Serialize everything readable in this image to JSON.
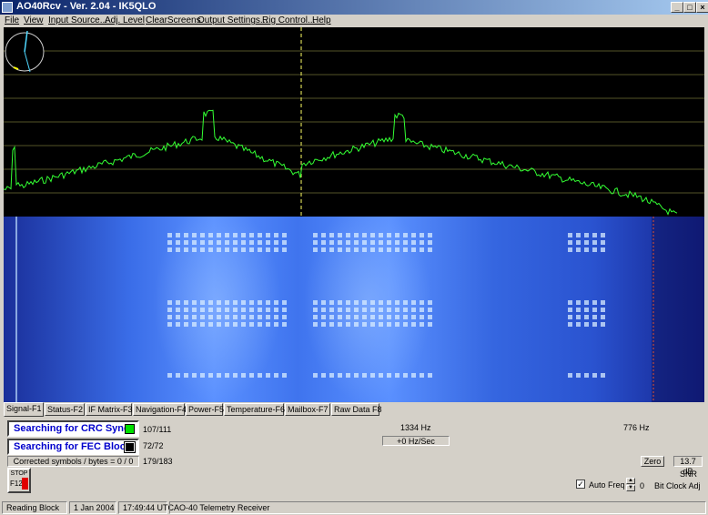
{
  "window": {
    "title": "AO40Rcv - Ver. 2.04 - IK5QLO"
  },
  "menu": [
    "File",
    "View",
    "Input Source...",
    "Adj. Level",
    "ClearScreens",
    "Output Settings...",
    "Rig Control...",
    "Help"
  ],
  "tabs": [
    "Signal-F1",
    "Status-F2",
    "IF Matrix-F3",
    "Navigation-F4",
    "Power-F5",
    "Temperature-F6",
    "Mailbox-F7",
    "Raw Data F8"
  ],
  "signal": {
    "crc_status": "Searching for CRC Sync",
    "crc_count": "107/111",
    "fec_status": "Searching for FEC Block",
    "fec_count": "72/72",
    "corrected_label": "Corrected symbols / bytes = 0 / 0",
    "corrected_count": "179/183",
    "freq_hz": "1334 Hz",
    "drift": "+0 Hz/Sec",
    "tune_freq": "776 Hz",
    "zero_label": "Zero",
    "snr_value": "13.7 dB",
    "snr_label": "SNR",
    "stop_label": "STOP",
    "stop_key": "F12",
    "auto_freq_label": "Auto Freq",
    "bit_clock_value": "0",
    "bit_clock_label": "Bit Clock Adj"
  },
  "statusbar": [
    "Reading Block",
    "1 Jan 2004",
    "17:49:44 UTC",
    "AO-40 Telemetry Receiver"
  ],
  "colors": {
    "trace": "#33ff33",
    "marker": "#ffff66",
    "grid": "#c8c860"
  }
}
